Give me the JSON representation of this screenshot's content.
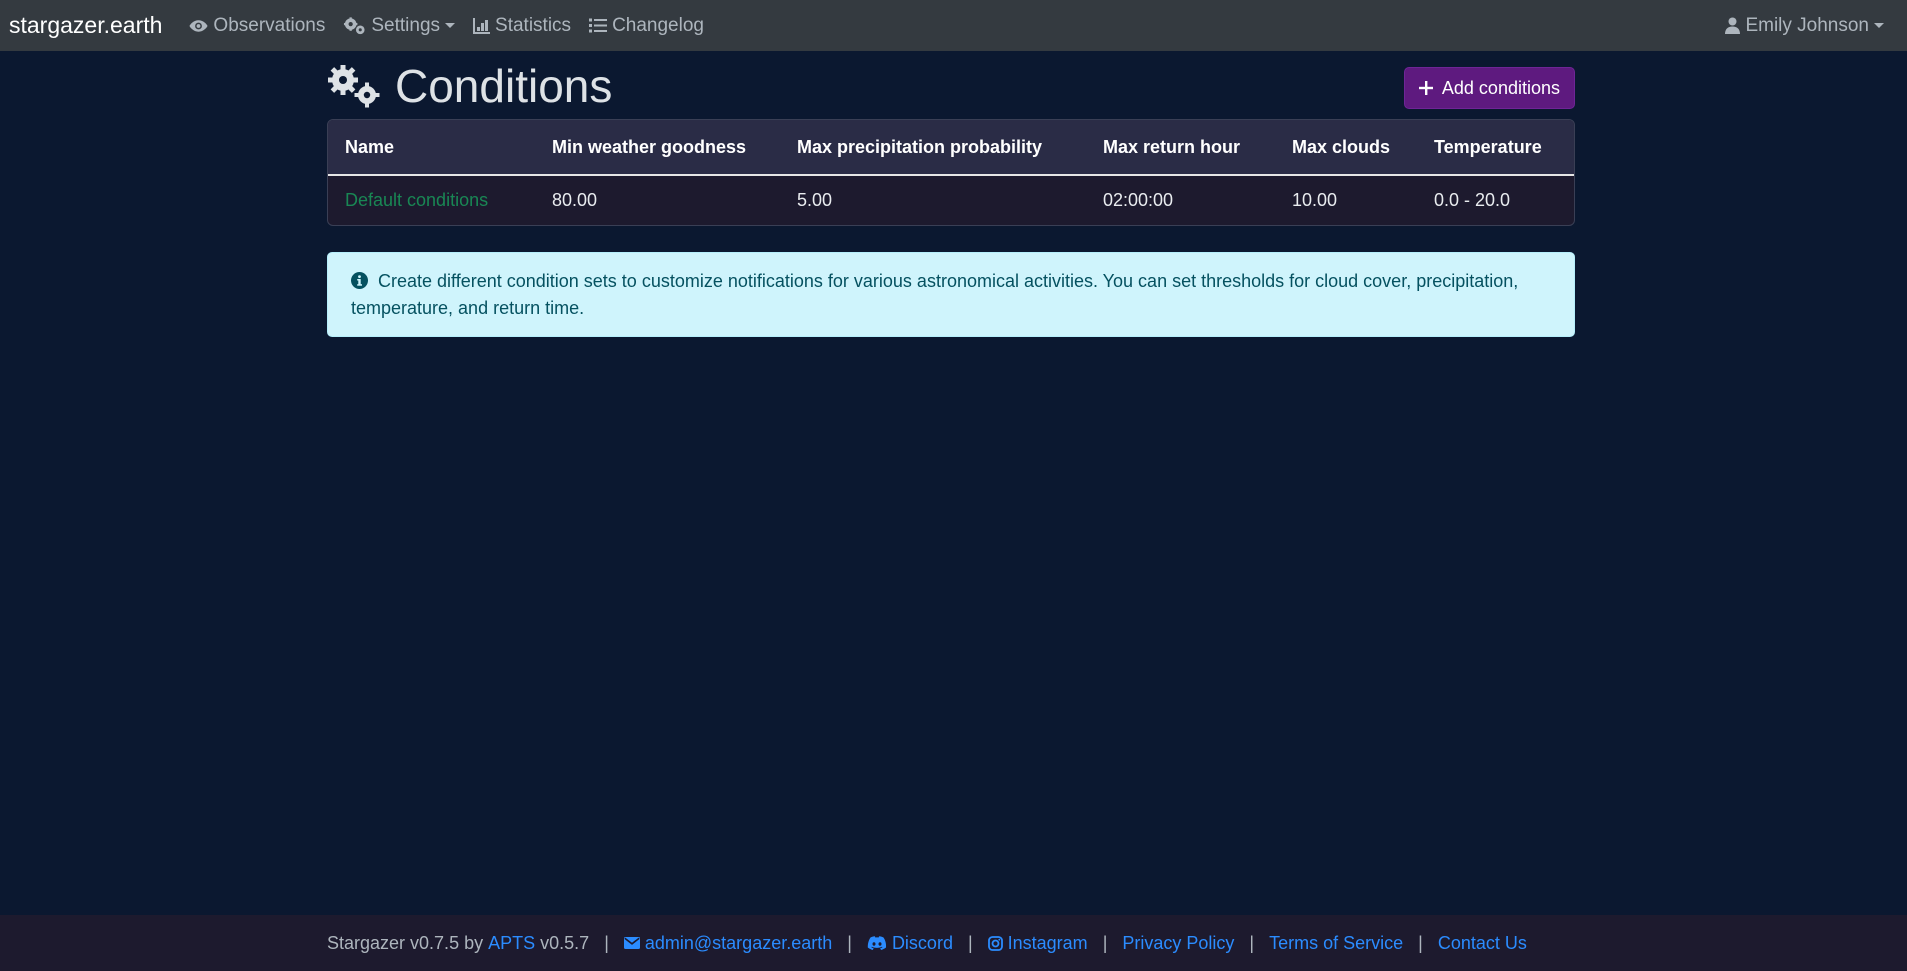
{
  "navbar": {
    "brand": "stargazer.earth",
    "items": [
      {
        "label": "Observations",
        "icon": "eye-icon"
      },
      {
        "label": "Settings",
        "icon": "gears-icon",
        "dropdown": true
      },
      {
        "label": "Statistics",
        "icon": "chart-icon"
      },
      {
        "label": "Changelog",
        "icon": "list-icon"
      }
    ],
    "user": {
      "label": "Emily Johnson",
      "icon": "user-icon"
    }
  },
  "page": {
    "title": "Conditions",
    "title_icon": "gears-icon",
    "add_button": "Add conditions"
  },
  "table": {
    "headers": [
      "Name",
      "Min weather goodness",
      "Max precipitation probability",
      "Max return hour",
      "Max clouds",
      "Temperature"
    ],
    "rows": [
      {
        "name": "Default conditions",
        "min_weather_goodness": "80.00",
        "max_precipitation_probability": "5.00",
        "max_return_hour": "02:00:00",
        "max_clouds": "10.00",
        "temperature": "0.0 - 20.0"
      }
    ]
  },
  "info": {
    "icon": "info-circle-icon",
    "text": "Create different condition sets to customize notifications for various astronomical activities. You can set thresholds for cloud cover, precipitation, temperature, and return time."
  },
  "footer": {
    "app_text": "Stargazer v0.7.5 by",
    "apts_link": "APTS",
    "apts_version": "v0.5.7",
    "email": "admin@stargazer.earth",
    "discord": "Discord",
    "instagram": "Instagram",
    "privacy": "Privacy Policy",
    "terms": "Terms of Service",
    "contact": "Contact Us",
    "separator": "|"
  },
  "colors": {
    "background": "#0b1830",
    "navbar": "#343a40",
    "accent_button": "#5e1a7f",
    "link_green": "#198754",
    "link_blue": "#2b8cff",
    "info_bg": "#cff4fc"
  }
}
